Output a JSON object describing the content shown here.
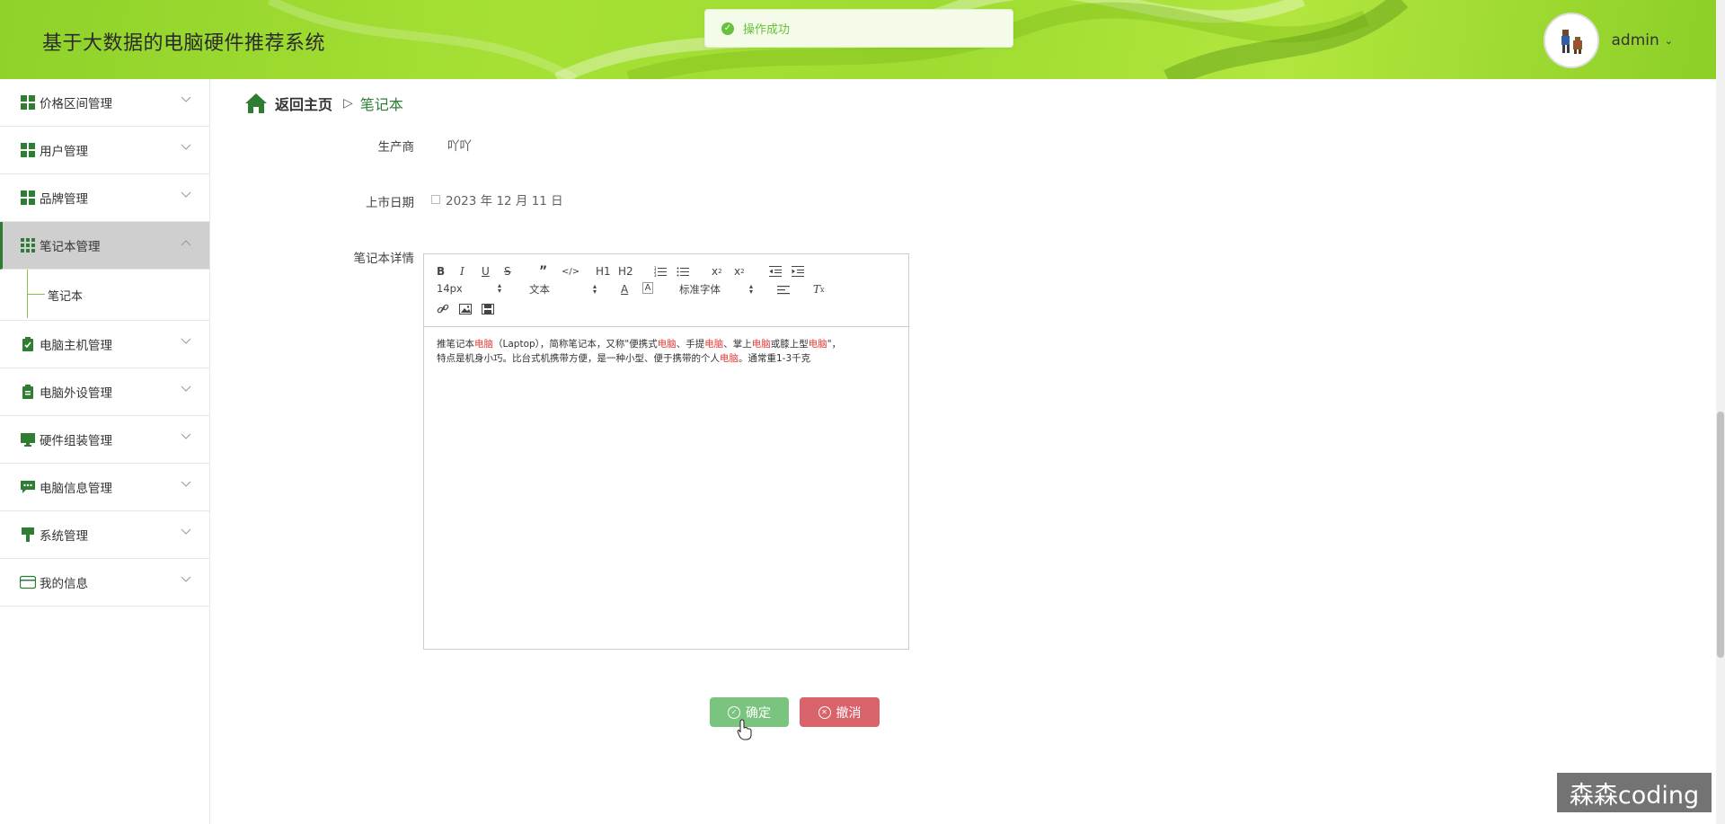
{
  "header": {
    "title": "基于大数据的电脑硬件推荐系统",
    "username": "admin"
  },
  "toast": {
    "message": "操作成功"
  },
  "sidebar": {
    "items": [
      {
        "label": "价格区间管理",
        "icon": "grid-icon"
      },
      {
        "label": "用户管理",
        "icon": "grid-icon"
      },
      {
        "label": "品牌管理",
        "icon": "grid-icon"
      },
      {
        "label": "笔记本管理",
        "icon": "apps-icon",
        "expanded": true
      },
      {
        "label": "电脑主机管理",
        "icon": "clipboard-check-icon"
      },
      {
        "label": "电脑外设管理",
        "icon": "clipboard-icon"
      },
      {
        "label": "硬件组装管理",
        "icon": "monitor-icon"
      },
      {
        "label": "电脑信息管理",
        "icon": "chat-icon"
      },
      {
        "label": "系统管理",
        "icon": "brush-icon"
      },
      {
        "label": "我的信息",
        "icon": "card-icon"
      }
    ],
    "submenu": {
      "label": "笔记本"
    }
  },
  "breadcrumb": {
    "home": "返回主页",
    "separator": "▷",
    "current": "笔记本"
  },
  "form": {
    "manufacturer_label": "生产商",
    "manufacturer_value": "吖吖",
    "release_date_label": "上市日期",
    "release_date_value": "2023 年 12 月 11 日",
    "details_label": "笔记本详情"
  },
  "editor": {
    "font_size": "14px",
    "paragraph": "文本",
    "font_family": "标准字体",
    "h1": "H1",
    "h2": "H2",
    "content": {
      "line1_a": "推笔记本",
      "line1_b": "电脑",
      "line1_c": "（Laptop），简称笔记本，又称\"便携式",
      "line1_d": "电脑",
      "line1_e": "、手提",
      "line1_f": "电脑",
      "line1_g": "、掌上",
      "line1_h": "电脑",
      "line1_i": "或膝上型",
      "line1_j": "电脑",
      "line1_k": "\"，",
      "line2_a": "特点是机身小巧。比台式机携带方便，是一种小型、便于携带的个人",
      "line2_b": "电脑",
      "line2_c": "。通常重1-3千克"
    }
  },
  "buttons": {
    "confirm": "确定",
    "cancel": "撤消"
  },
  "watermark": "森森coding",
  "colors": {
    "header_green": "#a6e035",
    "accent_green": "#2e7d32",
    "confirm_button": "#7bc47f",
    "cancel_button": "#d9636a",
    "highlight_red": "#e53935"
  }
}
